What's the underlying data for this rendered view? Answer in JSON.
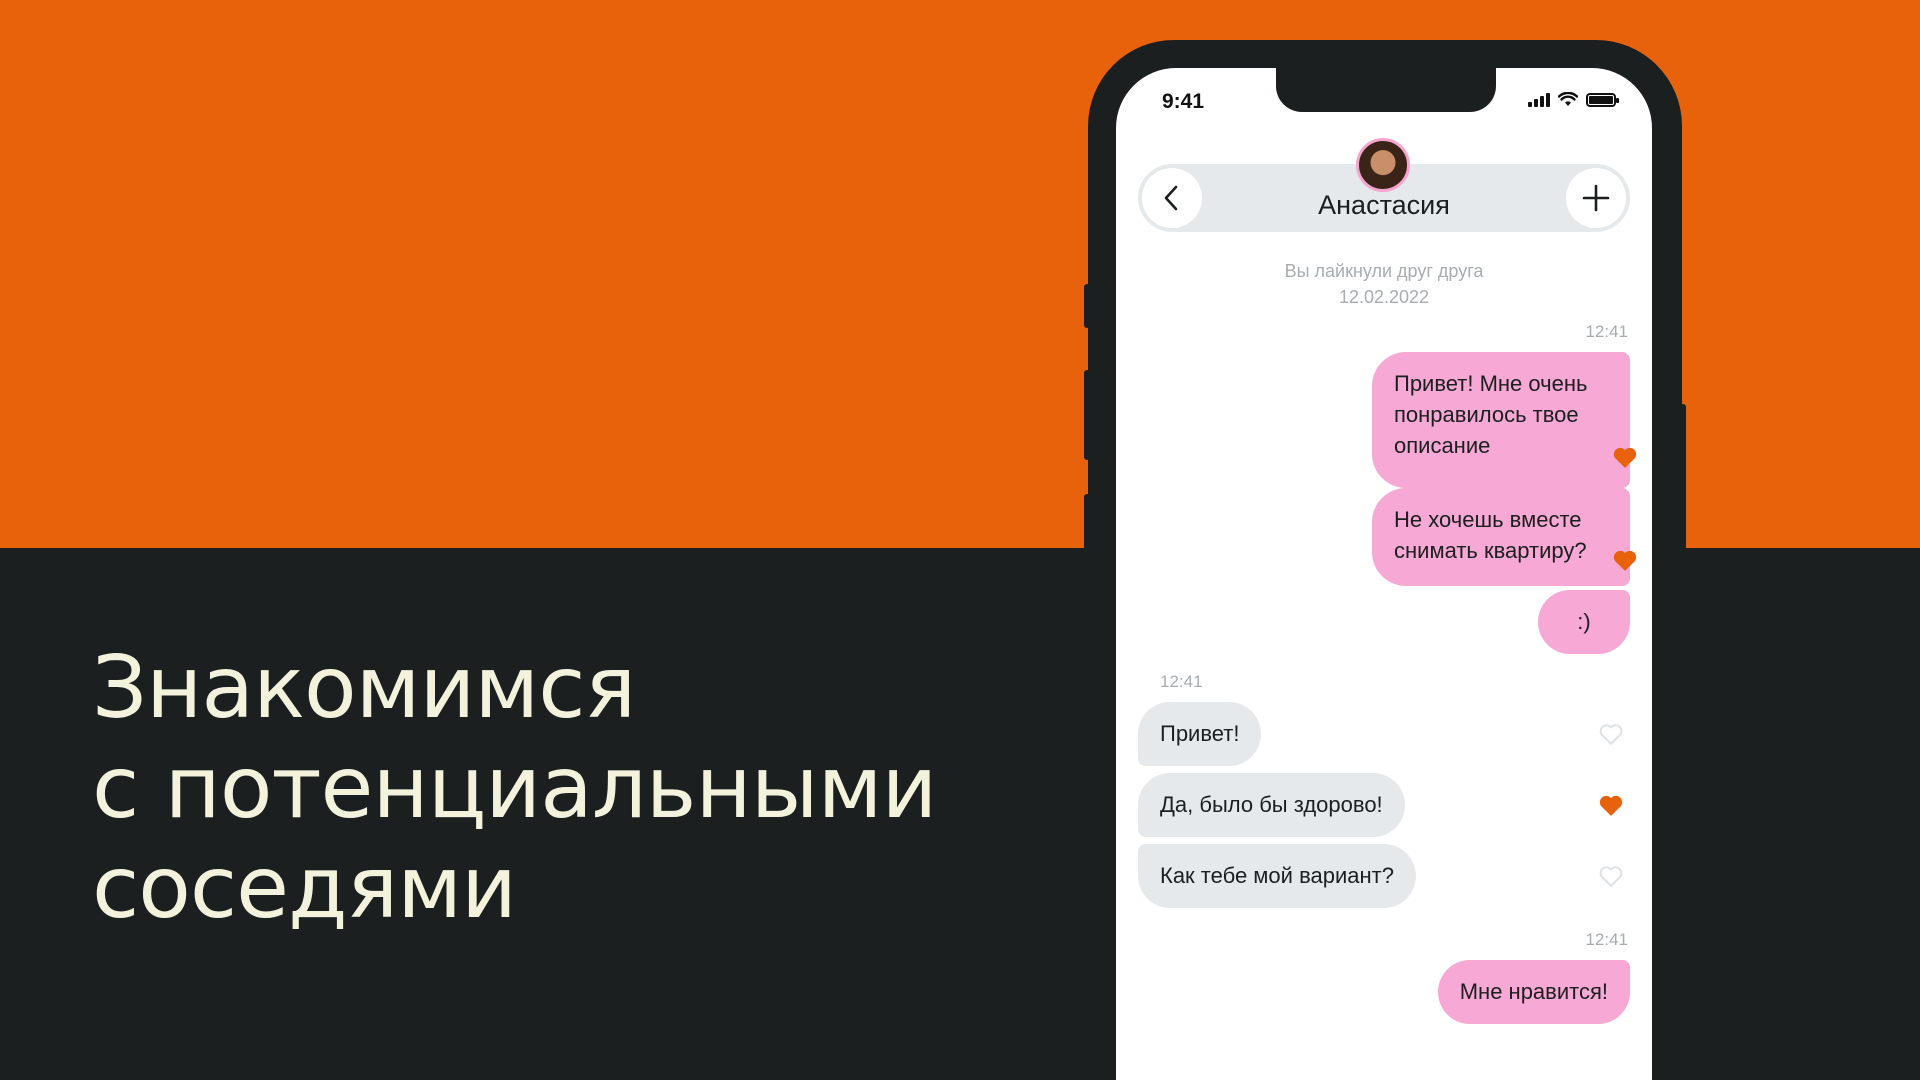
{
  "headline": {
    "lines": [
      "Знакомимся",
      "с потенциальными",
      "соседями"
    ]
  },
  "colors": {
    "accent_orange": "#e8620c",
    "dark_background": "#1b1f1f",
    "headline_text": "#f3f2dd",
    "outgoing_bubble": "#f7a8d5",
    "incoming_bubble": "#e6e9eb"
  },
  "phone": {
    "status_bar": {
      "time": "9:41",
      "icons": [
        "cellular-signal-icon",
        "wifi-icon",
        "battery-icon"
      ]
    },
    "chat_header": {
      "contact_name": "Анастасия",
      "back_icon": "chevron-left-icon",
      "add_icon": "plus-icon"
    },
    "match_note": {
      "text": "Вы лайкнули друг друга",
      "date": "12.02.2022"
    },
    "groups": [
      {
        "time": "12:41",
        "direction": "outgoing",
        "messages": [
          {
            "text": "Привет! Мне очень понравилось твое описание",
            "liked": true
          },
          {
            "text": "Не хочешь вместе снимать квартиру?",
            "liked": true
          },
          {
            "text": ":)",
            "liked": false
          }
        ]
      },
      {
        "time": "12:41",
        "direction": "incoming",
        "messages": [
          {
            "text": "Привет!",
            "liked": false
          },
          {
            "text": "Да, было бы здорово!",
            "liked": true
          },
          {
            "text": "Как тебе мой вариант?",
            "liked": false
          }
        ]
      },
      {
        "time": "12:41",
        "direction": "outgoing",
        "messages": [
          {
            "text": "Мне нравится!",
            "liked": false
          }
        ]
      }
    ]
  }
}
